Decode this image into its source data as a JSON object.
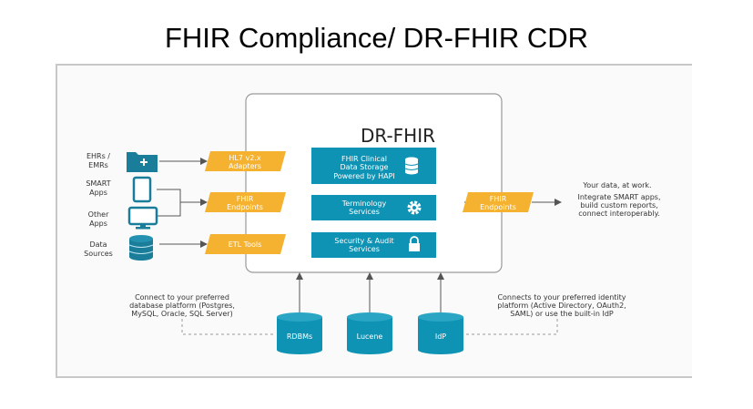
{
  "title": "FHIR Compliance/ DR-FHIR CDR",
  "brand": "DR-FHIR",
  "colors": {
    "teal": "#0f93b4",
    "orange": "#f5b230",
    "dark_teal": "#1a7d9a",
    "line": "#555555"
  },
  "sources": [
    {
      "lines": [
        "EHRs /",
        "EMRs"
      ],
      "icon": "folder-plus-icon"
    },
    {
      "lines": [
        "SMART",
        "Apps"
      ],
      "icon": "tablet-icon"
    },
    {
      "lines": [
        "Other",
        "Apps"
      ],
      "icon": "monitor-icon"
    },
    {
      "lines": [
        "Data",
        "Sources"
      ],
      "icon": "database-icon"
    }
  ],
  "inputs": [
    [
      "HL7 v2.x",
      "Adapters"
    ],
    [
      "FHIR",
      "Endpoints"
    ],
    [
      "ETL Tools"
    ]
  ],
  "services": [
    {
      "lines": [
        "FHIR Clinical",
        "Data Storage"
      ],
      "sub": "Powered by HAPI",
      "icon": "database-icon"
    },
    {
      "lines": [
        "Terminology",
        "Services"
      ],
      "icon": "gear-icon"
    },
    {
      "lines": [
        "Security & Audit",
        "Services"
      ],
      "icon": "lock-icon"
    }
  ],
  "output": {
    "lines": [
      "FHIR",
      "Endpoints"
    ]
  },
  "right_text": [
    "Your data, at work.",
    "Integrate SMART apps,",
    "build custom reports,",
    "connect interoperably."
  ],
  "backends": [
    "RDBMs",
    "Lucene",
    "IdP"
  ],
  "left_note": [
    "Connect to your preferred",
    "database platform (Postgres,",
    "MySQL, Oracle, SQL Server)"
  ],
  "right_note": [
    "Connects to your preferred identity",
    "platform (Active Directory, OAuth2,",
    "SAML) or use the built-in IdP"
  ]
}
